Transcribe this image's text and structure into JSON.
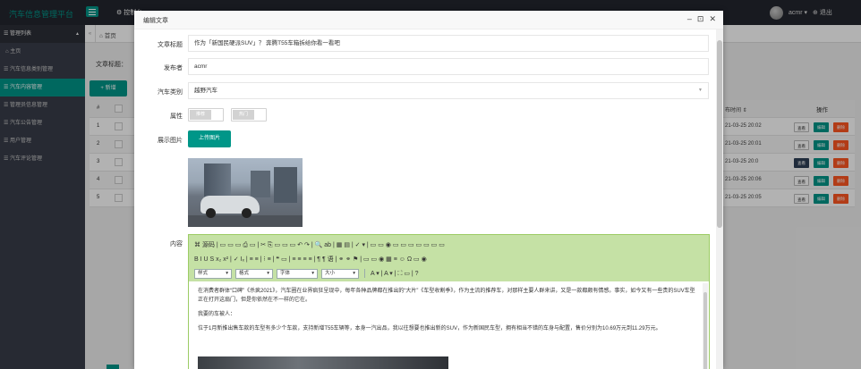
{
  "app": {
    "brand": "汽车信息管理平台",
    "top_tab": "⚙ 控制台",
    "user_name": "acmr ▾",
    "logout": "⊕ 退出"
  },
  "sidebar": {
    "section": "☰ 管理列表",
    "items": [
      {
        "label": "⌂ 主页"
      },
      {
        "label": "☰ 汽车信息类别管理"
      },
      {
        "label": "☰ 汽车内容管理"
      },
      {
        "label": "☰ 管理员信息管理"
      },
      {
        "label": "☰ 汽车公告管理"
      },
      {
        "label": "☰ 用户管理"
      },
      {
        "label": "☰ 汽车评论管理"
      }
    ]
  },
  "main": {
    "home_tab": "⌂ 首页",
    "search_label": "文章标题：",
    "add_button": "+ 新增",
    "table": {
      "headers": {
        "no": "#",
        "time_col": "布时间 ⇕",
        "op_col": "操作"
      },
      "rows": [
        {
          "no": "1",
          "time": "21-03-25 20:02"
        },
        {
          "no": "2",
          "time": "21-03-25 20:01"
        },
        {
          "no": "3",
          "time": "21-03-25 20:0"
        },
        {
          "no": "4",
          "time": "21-03-25 20:06"
        },
        {
          "no": "5",
          "time": "21-03-25 20:05"
        }
      ],
      "op_view": "查看",
      "op_edit": "编辑",
      "op_delete": "删除"
    }
  },
  "modal": {
    "title": "编辑文章",
    "controls": {
      "min": "–",
      "max": "⊡",
      "close": "✕"
    },
    "fields": {
      "title_label": "文章标题",
      "title_value": "作为「新国民硬派SUV」？ 奔腾T55车箱拆给你看一看吧",
      "publisher_label": "发布者",
      "publisher_value": "acmr",
      "category_label": "汽车类别",
      "category_value": "越野汽车",
      "attr_label": "属性",
      "attr_switch1": "推荐",
      "attr_switch2": "热门",
      "image_label": "展示图片",
      "upload_button": "上传图片",
      "content_label": "内容"
    },
    "editor": {
      "toolbar_row1": "⌘ 源码 | ▭ ▭ ▭ ⎙ ▭ | ✂ ⎘ ▭ ▭ ▭ ↶ ↷ | 🔍 ab | ▦ ▤ | ✓ ▾ | ▭ ▭ ◉ ▭ ▭ ▭ ▭ ▭ ▭ ▭",
      "toolbar_row2": "B I U S x₂ x² | ✓ Iₓ | ≡ ≡ | ⁝ ≡ | ❝ ▭ | ≡ ≡ ≡ ≡ | ¶ ¶ 语 | ⚭ ⚭ ⚑ | ▭ ▭ ◉ ▦ ≡ ☺ Ω ▭ ◉",
      "sel_style": "样式",
      "sel_format": "格式",
      "sel_font": "字体",
      "sel_size": "大小",
      "toolbar_row3_tail": "A ▾ | A ▾ | ⛶ ▭ | ?",
      "para1": "在消费者群体“口碑”《杀疯2021》，汽车圈在业界疯狂呈现中，每年各种品牌都在推出的“大片”《车型收割季》，作为主流的推荐车，对那样主要人群来讲，又是一款都颇有情感。事实，如今又有一些贵的SUV车型正在打开这扇门，但是你依然在不一样的它在。",
      "para2": "我要的车被人：",
      "para3": "位于1月新推出售车款的车型有多少个车款，支持新增T55车辆等，本身一汽出品，我以往想要也推出新的SUV，作为新国民车型，拥有相当不错的车身与配置，售价分别为10.69万元到11.29万元。"
    }
  }
}
